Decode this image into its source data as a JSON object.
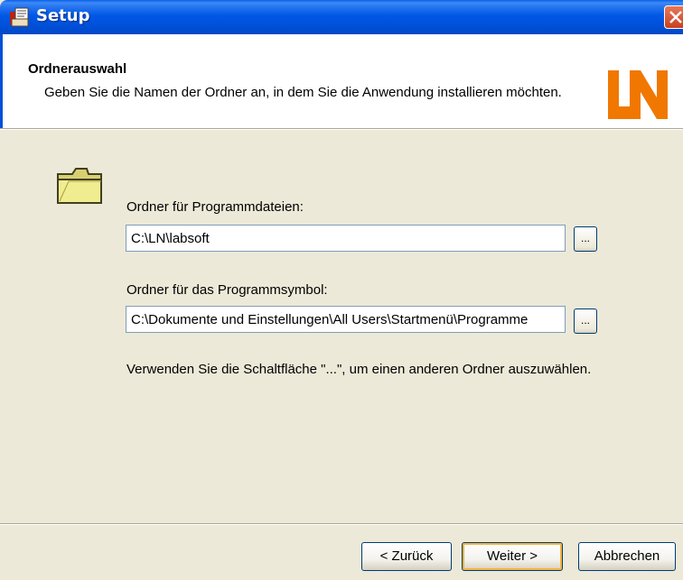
{
  "window": {
    "title": "Setup",
    "close_icon": "close-icon",
    "app_icon": "setup-app-icon"
  },
  "header": {
    "title": "Ordnerauswahl",
    "description": "Geben Sie die Namen der Ordner an, in dem Sie die Anwendung installieren möchten.",
    "logo_text": "LN",
    "logo_color": "#f07800"
  },
  "form": {
    "program_files_label": "Ordner für Programmdateien:",
    "program_files_value": "C:\\LN\\labsoft",
    "program_symbol_label": "Ordner für das Programmsymbol:",
    "program_symbol_value": "C:\\Dokumente und Einstellungen\\All Users\\Startmenü\\Programme",
    "browse_label": "...",
    "hint": "Verwenden Sie die Schaltfläche \"...\", um einen anderen Ordner auszuwählen."
  },
  "buttons": {
    "back": "< Zurück",
    "next": "Weiter >",
    "cancel": "Abbrechen"
  },
  "colors": {
    "titlebar": "#0050d8",
    "dialog_bg": "#ece9d8",
    "default_button_highlight": "#f6b340"
  }
}
